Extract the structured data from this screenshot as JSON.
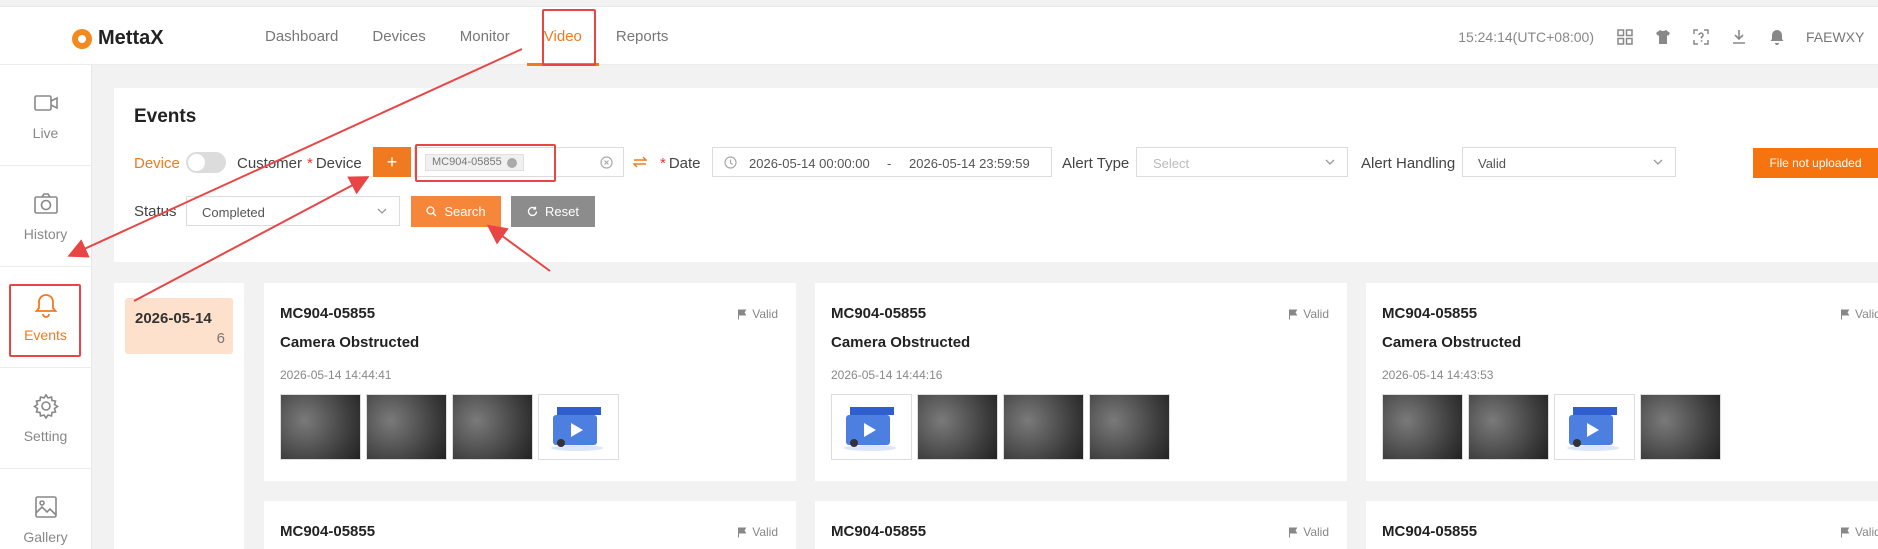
{
  "app": {
    "brand": "MettaX"
  },
  "nav": {
    "items": [
      "Dashboard",
      "Devices",
      "Monitor",
      "Video",
      "Reports"
    ],
    "active": "Video"
  },
  "header": {
    "clock": "15:24:14(UTC+08:00)",
    "user": "FAEWXY"
  },
  "sidebar": {
    "items": [
      {
        "label": "Live",
        "icon": "video-camera-icon"
      },
      {
        "label": "History",
        "icon": "camera-icon"
      },
      {
        "label": "Events",
        "icon": "bell-icon",
        "active": true
      },
      {
        "label": "Setting",
        "icon": "gear-icon"
      },
      {
        "label": "Gallery",
        "icon": "image-icon"
      }
    ]
  },
  "filters": {
    "title": "Events",
    "mode_device": "Device",
    "mode_customer": "Customer",
    "device_label": "Device",
    "add_symbol": "+",
    "device_tag": "MC904-05855",
    "date_label": "Date",
    "date_start": "2026-05-14 00:00:00",
    "date_sep": "-",
    "date_end": "2026-05-14 23:59:59",
    "alert_type_label": "Alert Type",
    "alert_type_placeholder": "Select",
    "alert_handling_label": "Alert Handling",
    "alert_handling_value": "Valid",
    "file_button": "File not uploaded",
    "status_label": "Status",
    "status_value": "Completed",
    "search_button": "Search",
    "reset_button": "Reset"
  },
  "dates": [
    {
      "date": "2026-05-14",
      "count": "6"
    }
  ],
  "events": [
    {
      "device": "MC904-05855",
      "status": "Valid",
      "type": "Camera Obstructed",
      "time": "2026-05-14 14:44:41",
      "thumbs": [
        "image",
        "image",
        "image",
        "video"
      ]
    },
    {
      "device": "MC904-05855",
      "status": "Valid",
      "type": "Camera Obstructed",
      "time": "2026-05-14 14:44:16",
      "thumbs": [
        "video",
        "image",
        "image",
        "image"
      ]
    },
    {
      "device": "MC904-05855",
      "status": "Valid",
      "type": "Camera Obstructed",
      "time": "2026-05-14 14:43:53",
      "thumbs": [
        "image",
        "image",
        "video",
        "image"
      ]
    },
    {
      "device": "MC904-05855",
      "status": "Valid"
    },
    {
      "device": "MC904-05855",
      "status": "Valid"
    },
    {
      "device": "MC904-05855",
      "status": "Valid"
    }
  ],
  "colors": {
    "accent": "#f07a1f",
    "annotation": "#e84545",
    "date_highlight": "#fde1cc",
    "reset_button": "#8c8c8c"
  }
}
